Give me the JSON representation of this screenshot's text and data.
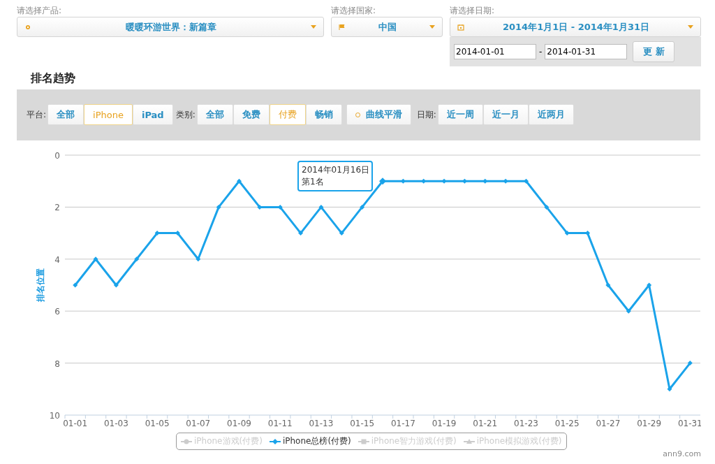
{
  "product_select": {
    "label": "请选择产品:",
    "value": "暖暖环游世界：新篇章"
  },
  "country_select": {
    "label": "请选择国家:",
    "value": "中国"
  },
  "date_select": {
    "label": "请选择日期:",
    "value": "2014年1月1日 - 2014年1月31日",
    "start": "2014-01-01",
    "separator": "-",
    "end": "2014-01-31",
    "button": "更 新"
  },
  "section_title": "排名趋势",
  "toolbar": [
    {
      "kind": "group",
      "label": "平台:",
      "options": [
        {
          "label": "全部",
          "selected": false
        },
        {
          "label": "iPhone",
          "selected": true
        },
        {
          "label": "iPad",
          "selected": false
        }
      ]
    },
    {
      "kind": "group",
      "label": "类别:",
      "options": [
        {
          "label": "全部",
          "selected": false
        },
        {
          "label": "免费",
          "selected": false
        },
        {
          "label": "付费",
          "selected": true
        },
        {
          "label": "畅销",
          "selected": false
        }
      ]
    },
    {
      "kind": "toggle",
      "label": "曲线平滑",
      "on": false
    },
    {
      "kind": "group",
      "label": "日期:",
      "options": [
        {
          "label": "近一周",
          "selected": false
        },
        {
          "label": "近一月",
          "selected": false
        },
        {
          "label": "近两月",
          "selected": false
        }
      ]
    }
  ],
  "chart": {
    "chart_data": {
      "type": "line",
      "ylabel": "排名位置",
      "categories": [
        "01-01",
        null,
        "01-03",
        null,
        "01-05",
        null,
        "01-07",
        null,
        "01-09",
        null,
        "01-11",
        null,
        "01-13",
        null,
        "01-15",
        null,
        "01-17",
        null,
        "01-19",
        null,
        "01-21",
        null,
        "01-23",
        null,
        "01-25",
        null,
        "01-27",
        null,
        "01-29",
        null,
        "01-31"
      ],
      "ylim": [
        10,
        0
      ],
      "yticks": [
        0,
        2,
        4,
        6,
        8,
        10
      ],
      "grid": true,
      "series": [
        {
          "color": "#1aa3ea",
          "marker": "diamond",
          "values": [
            5,
            4,
            5,
            4,
            3,
            3,
            4,
            2,
            1,
            2,
            2,
            3,
            2,
            3,
            2,
            1,
            1,
            1,
            1,
            1,
            1,
            1,
            1,
            2,
            3,
            3,
            5,
            6,
            5,
            9,
            8
          ]
        }
      ]
    },
    "tooltip": {
      "lines": [
        "2014年01月16日",
        "第1名"
      ]
    },
    "legend": [
      {
        "label": "iPhone游戏(付费)",
        "visible": false
      },
      {
        "label": "iPhone总榜(付费)",
        "visible": true
      },
      {
        "label": "iPhone智力游戏(付费)",
        "visible": false
      },
      {
        "label": "iPhone模拟游戏(付费)",
        "visible": false
      }
    ],
    "credits": "ann9.com"
  }
}
